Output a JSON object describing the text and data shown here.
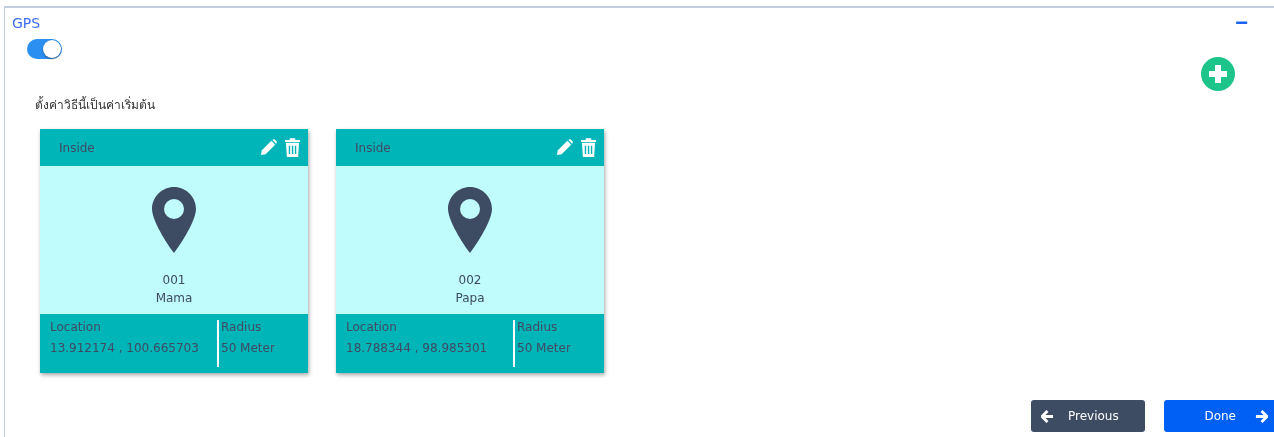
{
  "panel": {
    "title": "GPS",
    "collapse_symbol": "−"
  },
  "default_toggle": {
    "on": true
  },
  "default_label": "ตั้งค่าวิธีนี้เป็นค่าเริ่มต้น",
  "places": [
    {
      "zone": "Inside",
      "code": "001",
      "name": "Mama",
      "location_label": "Location",
      "location": "13.912174 , 100.665703",
      "radius_label": "Radius",
      "radius": "50 Meter"
    },
    {
      "zone": "Inside",
      "code": "002",
      "name": "Papa",
      "location_label": "Location",
      "location": "18.788344 , 98.985301",
      "radius_label": "Radius",
      "radius": "50 Meter"
    }
  ],
  "buttons": [
    {
      "kind": "back",
      "label": "Previous"
    },
    {
      "kind": "next",
      "label": "Done"
    }
  ]
}
